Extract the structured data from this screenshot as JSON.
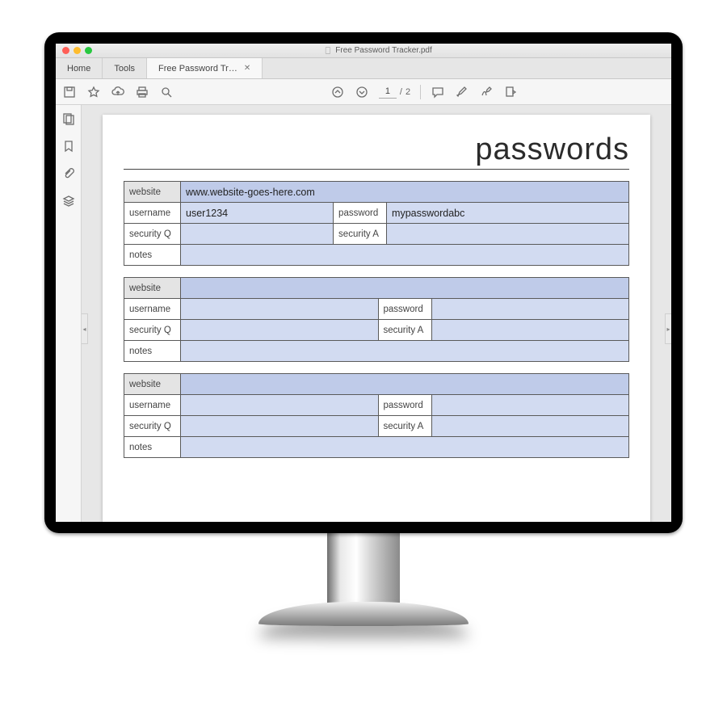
{
  "window": {
    "title": "Free Password Tracker.pdf"
  },
  "tabs": {
    "home": "Home",
    "tools": "Tools",
    "doc": "Free Password Tr…"
  },
  "toolbar": {
    "page_current": "1",
    "page_sep": "/",
    "page_total": "2"
  },
  "document": {
    "heading": "passwords",
    "labels": {
      "website": "website",
      "username": "username",
      "password": "password",
      "securityQ": "security Q",
      "securityA": "security A",
      "notes": "notes"
    },
    "entries": [
      {
        "website": "www.website-goes-here.com",
        "username": "user1234",
        "password": "mypasswordabc",
        "securityQ": "",
        "securityA": "",
        "notes": ""
      },
      {
        "website": "",
        "username": "",
        "password": "",
        "securityQ": "",
        "securityA": "",
        "notes": ""
      },
      {
        "website": "",
        "username": "",
        "password": "",
        "securityQ": "",
        "securityA": "",
        "notes": ""
      }
    ]
  }
}
